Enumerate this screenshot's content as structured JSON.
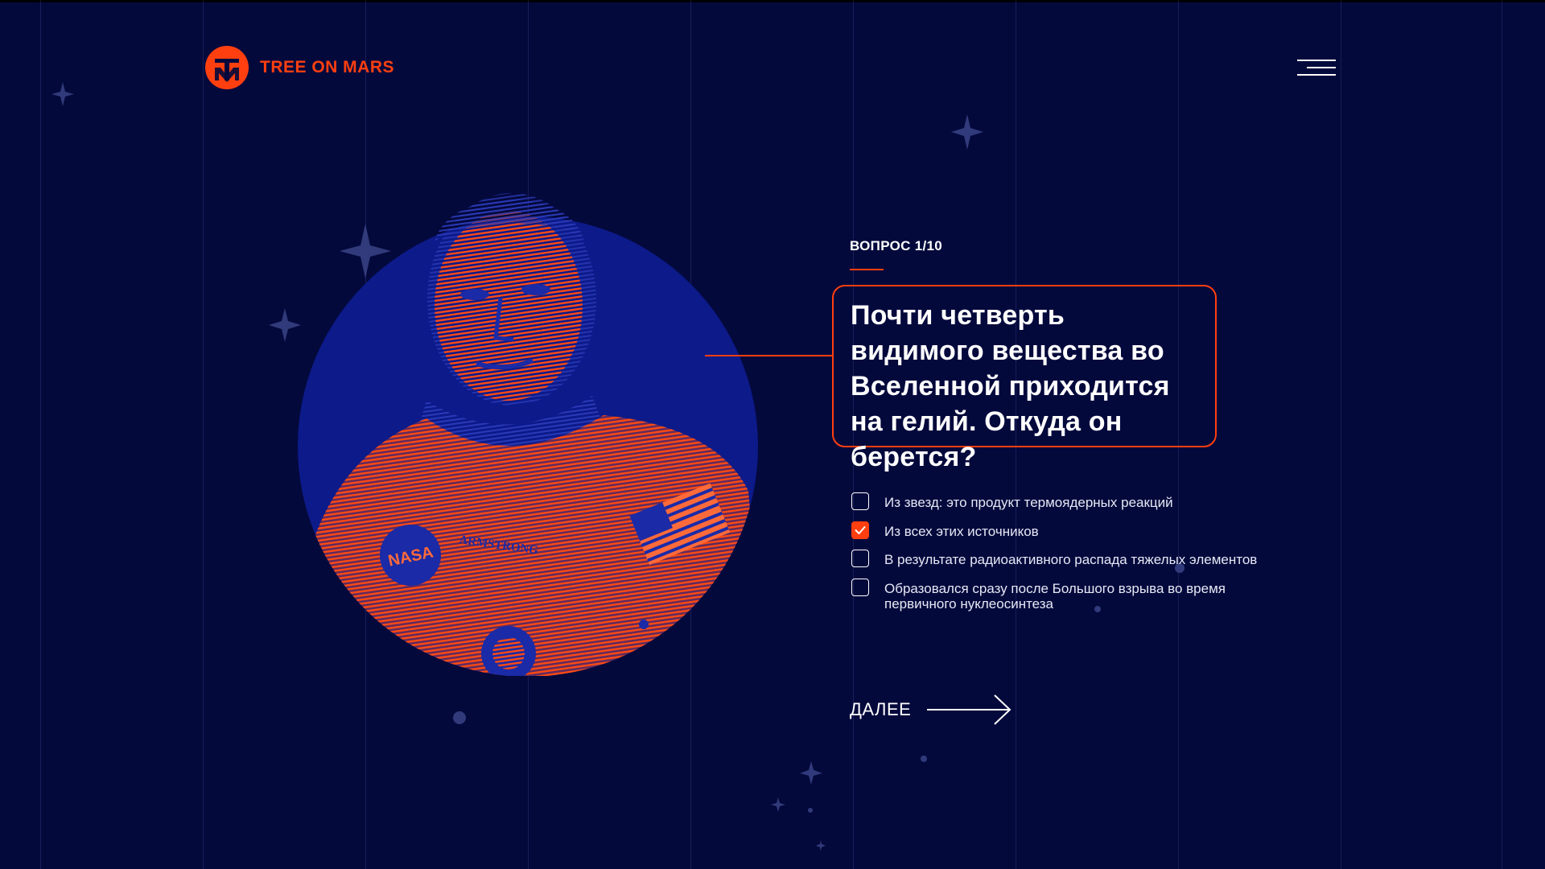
{
  "brand": {
    "name": "TREE ON MARS",
    "accent_color": "#ff3f0f",
    "background_color": "#04093c"
  },
  "header": {
    "menu_icon": "hamburger-menu-icon"
  },
  "portrait": {
    "alt": "Astronaut in orange space suit",
    "suit_patches": [
      "NASA",
      "ARMSTRONG"
    ]
  },
  "quiz": {
    "counter": "ВОПРОС 1/10",
    "question": "Почти четверть видимого вещества во Вселенной приходится на гелий. Откуда он берется?",
    "options": [
      {
        "label": "Из звезд: это продукт термоядерных реакций",
        "checked": false
      },
      {
        "label": "Из всех этих источников",
        "checked": true
      },
      {
        "label": "В результате радиоактивного распада тяжелых элементов",
        "checked": false
      },
      {
        "label": "Образовался сразу после Большого взрыва во время первичного нуклеосинтеза",
        "checked": false
      }
    ],
    "next_label": "ДАЛЕЕ",
    "next_icon": "arrow-right-icon"
  }
}
